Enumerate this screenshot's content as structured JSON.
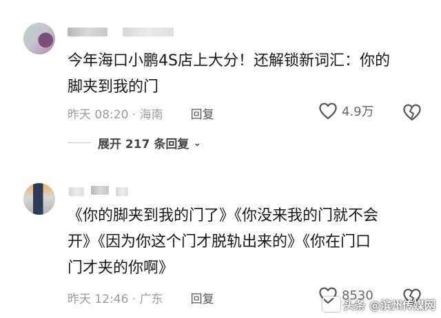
{
  "comments": [
    {
      "text": "今年海口小鹏4S店上大分！还解锁新词汇：你的\n脚夹到我的门",
      "time_location": "昨天 08:20 · 海南",
      "reply_label": "回复",
      "like_count": "4.9万",
      "expand_label": "展开 217 条回复"
    },
    {
      "text": "《你的脚夹到我的门了》《你没来我的门就不会\n开》《因为你这个门才脱轨出来的》《你在门口\n门才夹的你啊》",
      "time_location": "昨天 12:46 · 广东",
      "reply_label": "回复",
      "like_count": "8530"
    }
  ],
  "watermark": "头条 @滨州传媒网",
  "icons": {
    "like": "heart-outline-icon",
    "dislike": "broken-heart-icon",
    "expand": "chevron-down-icon"
  },
  "colors": {
    "text": "#161616",
    "meta": "#9b9b9b",
    "background": "#ffffff"
  }
}
